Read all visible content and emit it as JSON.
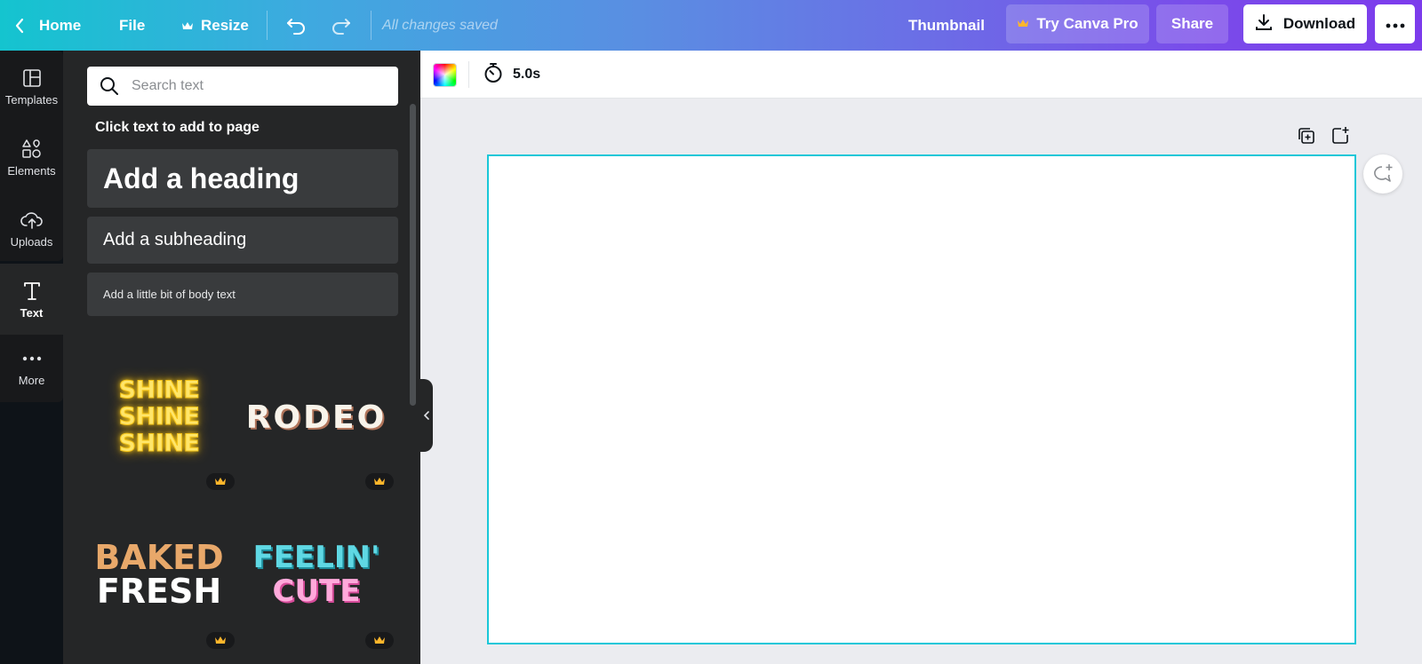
{
  "topbar": {
    "home_label": "Home",
    "file_label": "File",
    "resize_label": "Resize",
    "saved_status": "All changes saved",
    "doc_title": "Thumbnail",
    "try_pro_label": "Try Canva Pro",
    "share_label": "Share",
    "download_label": "Download"
  },
  "rail": {
    "items": [
      {
        "label": "Templates",
        "icon": "templates-icon"
      },
      {
        "label": "Elements",
        "icon": "elements-icon"
      },
      {
        "label": "Uploads",
        "icon": "uploads-icon"
      },
      {
        "label": "Text",
        "icon": "text-icon",
        "active": true
      },
      {
        "label": "More",
        "icon": "more-icon"
      }
    ]
  },
  "panel": {
    "search_placeholder": "Search text",
    "hint": "Click text to add to page",
    "heading_card": "Add a heading",
    "subheading_card": "Add a subheading",
    "body_card": "Add a little bit of body text",
    "styles": [
      {
        "lines": [
          "SHINE",
          "SHINE",
          "SHINE"
        ],
        "pro": true
      },
      {
        "lines": [
          "RODEO"
        ],
        "pro": true
      },
      {
        "lines": [
          "BAKED",
          "FRESH"
        ],
        "pro": true
      },
      {
        "lines": [
          "FEELIN'",
          "CUTE"
        ],
        "pro": true
      }
    ]
  },
  "editor": {
    "duration": "5.0s"
  },
  "colors": {
    "accent_gradient_start": "#14c4cf",
    "accent_gradient_end": "#7c3bec",
    "selection_border": "#19c7d8",
    "pro_crown": "#ffb62b"
  }
}
